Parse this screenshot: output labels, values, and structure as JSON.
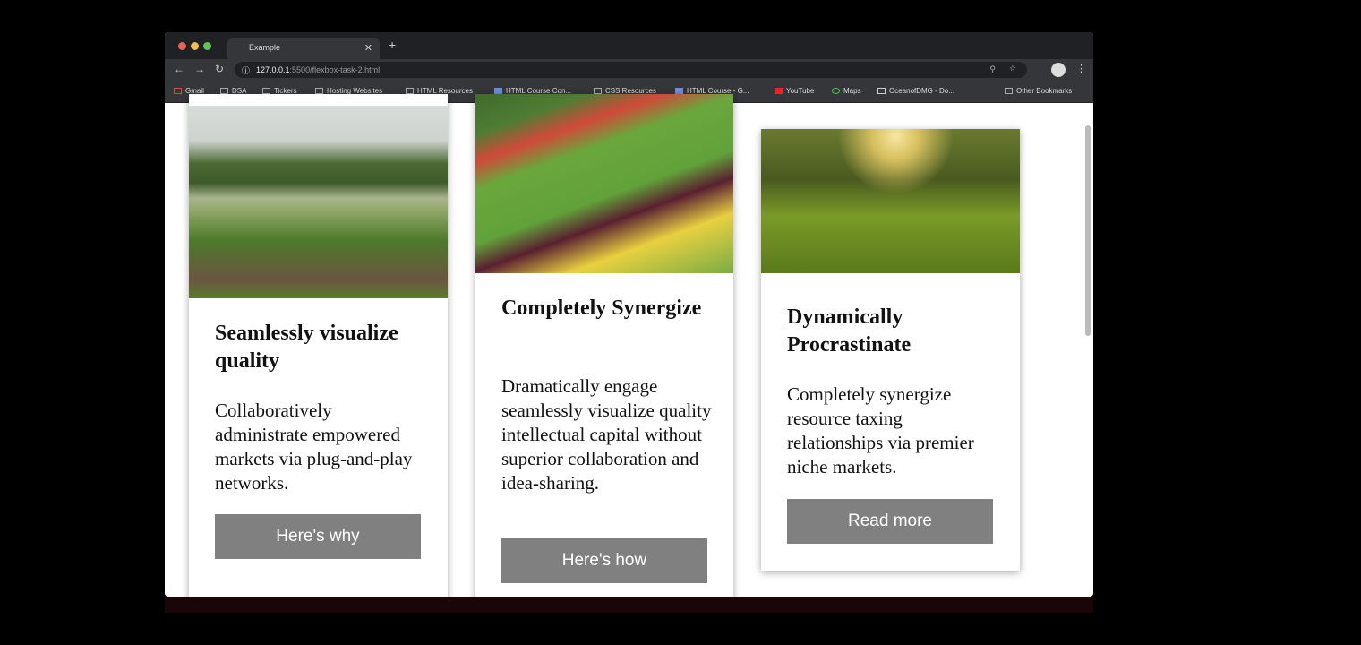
{
  "browser": {
    "tab_title": "Example",
    "url_host": "127.0.0.1",
    "url_rest": ":5500/flexbox-task-2.html",
    "bookmarks": [
      "Gmail",
      "DSA",
      "Tickers",
      "Hosting Websites",
      "HTML Resources",
      "HTML Course Con...",
      "CSS Resources",
      "HTML Course - G...",
      "YouTube",
      "Maps",
      "OceanofDMG - Do..."
    ],
    "other_bookmarks": "Other Bookmarks"
  },
  "cards": [
    {
      "title": "Seamlessly visualize quality",
      "text": "Collaboratively administrate empowered markets via plug-and-play networks.",
      "button": "Here's why"
    },
    {
      "title": "Completely Synergize",
      "text": "Dramatically engage seamlessly visualize quality intellectual capital without superior collaboration and idea-sharing.",
      "button": "Here's how"
    },
    {
      "title": "Dynamically Procrastinate",
      "text": "Completely synergize resource taxing relationships via premier niche markets.",
      "button": "Read more"
    }
  ]
}
